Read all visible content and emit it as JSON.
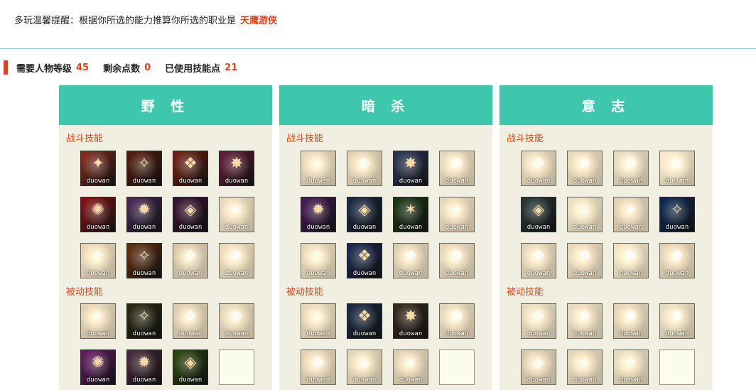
{
  "notice": {
    "text": "多玩温馨提醒：根据你所选的能力推算你所选的职业是",
    "class_name": "天鹰游侠"
  },
  "stats": {
    "level_label": "需要人物等级",
    "level_value": "45",
    "remaining_label": "剩余点数",
    "remaining_value": "0",
    "used_label": "已使用技能点",
    "used_value": "21"
  },
  "colors": {
    "accent": "#e2401a",
    "header_teal": "#3fc7ad",
    "section_text": "#d5461a",
    "panel_bg": "#f0efe2",
    "empty_slot": "#f2e4b0"
  },
  "panels": [
    {
      "title": "野 性",
      "combat_label": "战斗技能",
      "passive_label": "被动技能",
      "combat": [
        {
          "icon": "spear-slash-icon",
          "active": true,
          "wm": "duowan",
          "color": "#8a2a1a"
        },
        {
          "icon": "blood-drop-icon",
          "active": true,
          "wm": "duowan",
          "color": "#5a1a0a"
        },
        {
          "icon": "arrow-strike-icon",
          "active": true,
          "wm": "duowan",
          "color": "#7a2010"
        },
        {
          "icon": "beast-claw-icon",
          "active": true,
          "wm": "duowan",
          "color": "#6a1a3a"
        },
        {
          "icon": "target-man-icon",
          "active": true,
          "wm": "duowan",
          "color": "#8a1010"
        },
        {
          "icon": "armored-fist-icon",
          "active": true,
          "wm": "duowan",
          "color": "#4a2a5a"
        },
        {
          "icon": "shadow-figure-icon",
          "active": true,
          "wm": "duowan",
          "color": "#3a1030"
        },
        {
          "icon": "net-trap-icon",
          "active": false,
          "wm": "duowan",
          "color": "#b7a57a"
        },
        {
          "icon": "dagger-icon",
          "active": false,
          "wm": "duowan",
          "color": "#c79a80"
        },
        {
          "icon": "triple-blade-icon",
          "active": true,
          "wm": "duowan",
          "color": "#6a3010"
        },
        {
          "icon": "hooded-figure-icon",
          "active": false,
          "wm": "duowan",
          "color": "#b08a70"
        },
        {
          "icon": "glowing-head-icon",
          "active": false,
          "wm": "duowan",
          "color": "#b8aa70"
        }
      ],
      "passive": [
        {
          "icon": "wolf-icon",
          "active": false,
          "wm": "duowan",
          "color": "#b89a70"
        },
        {
          "icon": "sparkle-eyes-icon",
          "active": true,
          "wm": "duowan",
          "color": "#2a2a10"
        },
        {
          "icon": "feather-blade-icon",
          "active": false,
          "wm": "duowan",
          "color": "#c08a80"
        },
        {
          "icon": "arrow-shot-icon",
          "active": false,
          "wm": "duowan",
          "color": "#a8a080"
        },
        {
          "icon": "bow-icon",
          "active": true,
          "wm": "duowan",
          "color": "#6a1a6a"
        },
        {
          "icon": "hawk-icon",
          "active": true,
          "wm": "duowan",
          "color": "#4a2a3a"
        },
        {
          "icon": "paw-print-icon",
          "active": true,
          "wm": "duowan",
          "color": "#2a4a0a"
        },
        {
          "icon": "empty-slot",
          "active": false,
          "wm": "",
          "color": "#f2e4b0",
          "empty": true
        }
      ]
    },
    {
      "title": "暗 杀",
      "combat_label": "战斗技能",
      "passive_label": "被动技能",
      "combat": [
        {
          "icon": "curved-blade-icon",
          "active": false,
          "wm": "duowan",
          "color": "#c0a070"
        },
        {
          "icon": "slash-arc-icon",
          "active": false,
          "wm": "duowan",
          "color": "#c09a70"
        },
        {
          "icon": "spirit-figure-icon",
          "active": true,
          "wm": "duowan",
          "color": "#2a3a5a"
        },
        {
          "icon": "sword-flash-icon",
          "active": false,
          "wm": "duowan",
          "color": "#c0a070"
        },
        {
          "icon": "crosshair-icon",
          "active": true,
          "wm": "duowan",
          "color": "#4a1a5a"
        },
        {
          "icon": "shadow-cloak-icon",
          "active": true,
          "wm": "duowan",
          "color": "#1a2a4a"
        },
        {
          "icon": "poison-blade-icon",
          "active": true,
          "wm": "duowan",
          "color": "#1a3a10"
        },
        {
          "icon": "quick-strike-icon",
          "active": false,
          "wm": "duowan",
          "color": "#c0a070"
        },
        {
          "icon": "cross-blades-icon",
          "active": false,
          "wm": "duowan",
          "color": "#c0a070"
        },
        {
          "icon": "lightning-dash-icon",
          "active": true,
          "wm": "duowan",
          "color": "#1a2a5a"
        },
        {
          "icon": "twin-shadows-icon",
          "active": false,
          "wm": "duowan",
          "color": "#a89a70"
        },
        {
          "icon": "crescent-slash-icon",
          "active": false,
          "wm": "duowan",
          "color": "#b8a070"
        }
      ],
      "passive": [
        {
          "icon": "blade-edge-icon",
          "active": false,
          "wm": "duowan",
          "color": "#c0a070"
        },
        {
          "icon": "energy-burst-icon",
          "active": true,
          "wm": "duowan",
          "color": "#1a2a4a"
        },
        {
          "icon": "hilt-icon",
          "active": true,
          "wm": "duowan",
          "color": "#3a2a1a"
        },
        {
          "icon": "body-aura-icon",
          "active": false,
          "wm": "duowan",
          "color": "#b8a070"
        },
        {
          "icon": "focus-eye-icon",
          "active": false,
          "wm": "duowan",
          "color": "#c09a70"
        },
        {
          "icon": "cat-eye-icon",
          "active": false,
          "wm": "duowan",
          "color": "#c0a070"
        },
        {
          "icon": "lurker-icon",
          "active": false,
          "wm": "duowan",
          "color": "#a89a70"
        },
        {
          "icon": "empty-slot",
          "active": false,
          "wm": "",
          "color": "#f2e4b0",
          "empty": true
        }
      ]
    },
    {
      "title": "意 志",
      "combat_label": "战斗技能",
      "passive_label": "被动技能",
      "combat": [
        {
          "icon": "meditation-icon",
          "active": false,
          "wm": "duowan",
          "color": "#c0a070"
        },
        {
          "icon": "sunburst-icon",
          "active": false,
          "wm": "duowan",
          "color": "#d0a060"
        },
        {
          "icon": "shield-cross-icon",
          "active": false,
          "wm": "duowan",
          "color": "#a8a890"
        },
        {
          "icon": "radiance-icon",
          "active": false,
          "wm": "duowan",
          "color": "#c0b890"
        },
        {
          "icon": "mind-split-icon",
          "active": true,
          "wm": "duowan",
          "color": "#2a3a3a"
        },
        {
          "icon": "light-beam-icon",
          "active": false,
          "wm": "duowan",
          "color": "#b0b080"
        },
        {
          "icon": "warrior-stance-icon",
          "active": false,
          "wm": "duowan",
          "color": "#b09a70"
        },
        {
          "icon": "psychic-head-icon",
          "active": true,
          "wm": "duowan",
          "color": "#0a2a5a"
        },
        {
          "icon": "rising-spike-icon",
          "active": false,
          "wm": "duowan",
          "color": "#b0a080"
        },
        {
          "icon": "energy-claw-icon",
          "active": false,
          "wm": "duowan",
          "color": "#c0a080"
        },
        {
          "icon": "orb-glow-icon",
          "active": false,
          "wm": "duowan",
          "color": "#b0b890"
        },
        {
          "icon": "flame-figure-icon",
          "active": false,
          "wm": "duowan",
          "color": "#c09a60"
        }
      ],
      "passive": [
        {
          "icon": "leaf-blade-icon",
          "active": false,
          "wm": "duowan",
          "color": "#b0a880"
        },
        {
          "icon": "aura-ring-icon",
          "active": false,
          "wm": "duowan",
          "color": "#c0a080"
        },
        {
          "icon": "chakra-figure-icon",
          "active": false,
          "wm": "duowan",
          "color": "#c09a70"
        },
        {
          "icon": "vial-icon",
          "active": false,
          "wm": "duowan",
          "color": "#b0a890"
        },
        {
          "icon": "eye-glow-icon",
          "active": false,
          "wm": "duowan",
          "color": "#c08a70"
        },
        {
          "icon": "golden-swirl-icon",
          "active": false,
          "wm": "duowan",
          "color": "#c0a060"
        },
        {
          "icon": "spirit-form-icon",
          "active": false,
          "wm": "duowan",
          "color": "#a8a890"
        },
        {
          "icon": "empty-slot",
          "active": false,
          "wm": "",
          "color": "#f2e4b0",
          "empty": true
        }
      ]
    }
  ]
}
